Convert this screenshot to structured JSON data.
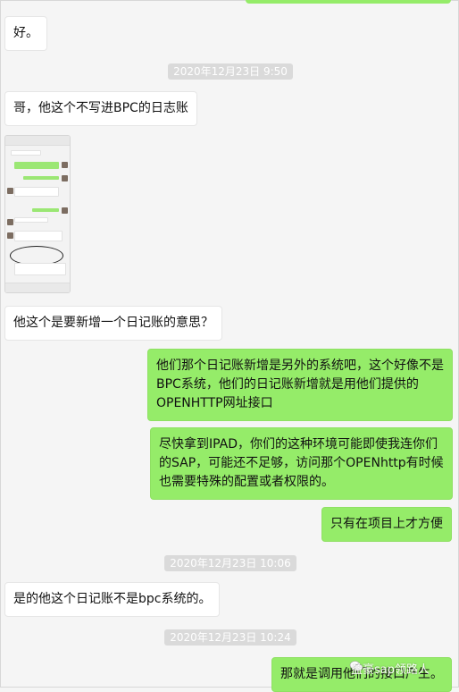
{
  "messages": [
    {
      "dir": "in",
      "text": "好。"
    },
    {
      "dir": "in",
      "text": "哥，他这个不写进BPC的日志账"
    },
    {
      "dir": "in",
      "text": "他这个是要新增一个日记账的意思？"
    },
    {
      "dir": "out",
      "lines": [
        "他们那个日记账新增是另外的系统吧，这个好像不是",
        "BPC系统，他们的日记账新增就是用他们提供的",
        "OPENHTTP网址接口"
      ]
    },
    {
      "dir": "out",
      "lines": [
        "尽快拿到IPAD，你们的这种环境可能即使我连你们",
        "的SAP，可能还不足够，访问那个OPENhttp有时候",
        "也需要特殊的配置或者权限的。"
      ]
    },
    {
      "dir": "out",
      "text": "只有在项目上才方便"
    },
    {
      "dir": "in",
      "text": "是的他这个日记账不是bpc系统的。"
    },
    {
      "dir": "out",
      "text": "那就是调用他们的接口产生。"
    }
  ],
  "timestamps": [
    "2020年12月23日 9:50",
    "2020年12月23日 10:06",
    "2020年12月23日 10:24"
  ],
  "watermark": "益豪sap领路人",
  "colors": {
    "outgoing": "#95ec69",
    "incoming": "#ffffff",
    "background": "#f5f5f5",
    "timestamp_bg": "#dadada"
  }
}
